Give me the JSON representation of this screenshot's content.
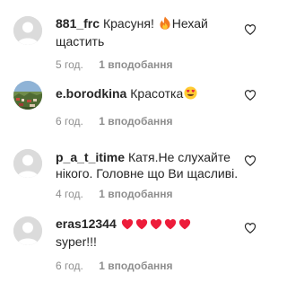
{
  "comments": [
    {
      "username": "881_frc",
      "text_before_emoji": "Красуня! ",
      "text_after_emoji": "Нехай щастить",
      "emoji": "fire-emoji",
      "time": "5 год.",
      "likes": "1 вподобання",
      "avatar": "default-avatar"
    },
    {
      "username": "e.borodkina",
      "text_before_emoji": "Красотка",
      "text_after_emoji": "",
      "emoji": "heart-eyes-emoji",
      "time": "6 год.",
      "likes": "1 вподобання",
      "avatar": "photo-avatar"
    },
    {
      "username": "p_a_t_itime",
      "text_before_emoji": "Катя.Не слухайте нікого. Головне що Ви щасливі.",
      "text_after_emoji": "",
      "emoji": "",
      "time": "4 год.",
      "likes": "1 вподобання",
      "avatar": "default-avatar"
    },
    {
      "username": "eras12344",
      "text_before_emoji": "",
      "text_after_emoji": "syper!!!",
      "emoji": "red-heart-emoji x5",
      "time": "6 год.",
      "likes": "1 вподобання",
      "avatar": "default-avatar"
    }
  ],
  "colors": {
    "text": "#262626",
    "secondary": "#8e8e8e",
    "avatar_bg": "#dbdbdb",
    "heart_red": "#ed1c3a"
  }
}
